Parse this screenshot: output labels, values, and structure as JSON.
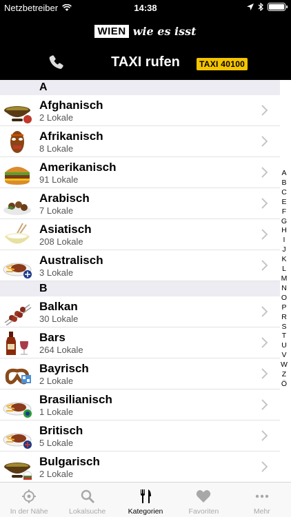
{
  "status_bar": {
    "carrier": "Netzbetreiber",
    "time": "14:38"
  },
  "header": {
    "logo_box": "WIEN",
    "logo_slogan": "wie es isst",
    "taxi_title": "TAXI rufen",
    "taxi_number": "TAXI 40100"
  },
  "sections": [
    {
      "letter": "A",
      "items": [
        {
          "name": "Afghanisch",
          "count": "2 Lokale",
          "icon": "soup-bowl-icon"
        },
        {
          "name": "Afrikanisch",
          "count": "8 Lokale",
          "icon": "african-mask-icon"
        },
        {
          "name": "Amerikanisch",
          "count": "91 Lokale",
          "icon": "burger-icon"
        },
        {
          "name": "Arabisch",
          "count": "7 Lokale",
          "icon": "falafel-plate-icon"
        },
        {
          "name": "Asiatisch",
          "count": "208 Lokale",
          "icon": "rice-bowl-chopsticks-icon"
        },
        {
          "name": "Australisch",
          "count": "3 Lokale",
          "icon": "steak-plate-icon"
        }
      ]
    },
    {
      "letter": "B",
      "items": [
        {
          "name": "Balkan",
          "count": "30 Lokale",
          "icon": "skewers-icon"
        },
        {
          "name": "Bars",
          "count": "264 Lokale",
          "icon": "bottle-glass-icon"
        },
        {
          "name": "Bayrisch",
          "count": "2 Lokale",
          "icon": "pretzel-icon"
        },
        {
          "name": "Brasilianisch",
          "count": "1 Lokale",
          "icon": "steak-plate-icon"
        },
        {
          "name": "Britisch",
          "count": "5 Lokale",
          "icon": "steak-plate-icon"
        },
        {
          "name": "Bulgarisch",
          "count": "2 Lokale",
          "icon": "soup-bowl-icon"
        }
      ]
    }
  ],
  "index_letters": [
    "A",
    "B",
    "C",
    "E",
    "F",
    "G",
    "H",
    "I",
    "J",
    "K",
    "L",
    "M",
    "N",
    "O",
    "P",
    "R",
    "S",
    "T",
    "U",
    "V",
    "W",
    "Z",
    "Ö"
  ],
  "tabs": [
    {
      "label": "In der Nähe",
      "icon": "location-icon",
      "active": false
    },
    {
      "label": "Lokalsuche",
      "icon": "search-icon",
      "active": false
    },
    {
      "label": "Kategorien",
      "icon": "cutlery-icon",
      "active": true
    },
    {
      "label": "Favoriten",
      "icon": "heart-icon",
      "active": false
    },
    {
      "label": "Mehr",
      "icon": "more-icon",
      "active": false
    }
  ],
  "colors": {
    "header_bg": "#000000",
    "taxi_badge": "#f5c400",
    "section_bg": "#ececf2",
    "tab_inactive": "#a8a8a8"
  }
}
